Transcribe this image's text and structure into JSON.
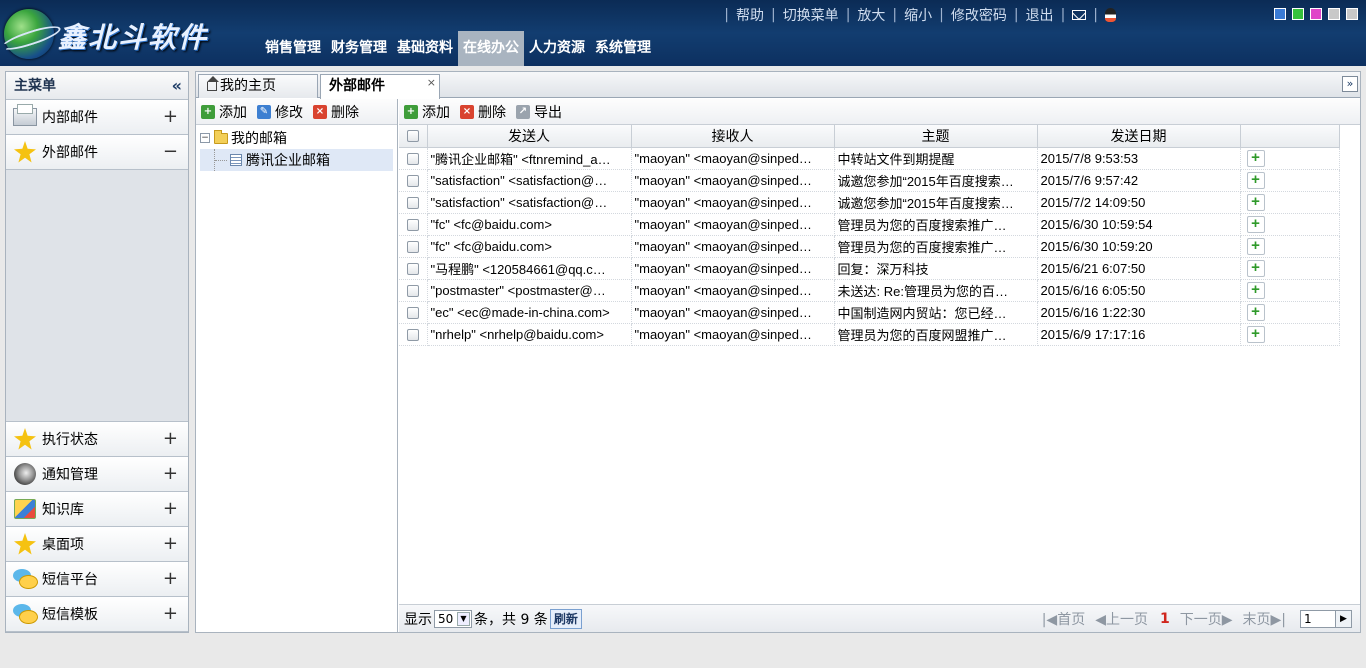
{
  "header": {
    "logo_text": "鑫北斗软件",
    "links": [
      "帮助",
      "切换菜单",
      "放大",
      "缩小",
      "修改密码",
      "退出"
    ],
    "nav": [
      "销售管理",
      "财务管理",
      "基础资料",
      "在线办公",
      "人力资源",
      "系统管理"
    ],
    "active_nav": "在线办公",
    "skin_colors": [
      "#3a7bd5",
      "#36c23b",
      "#e045c8",
      "#c8c8c8",
      "#c8c8c8"
    ]
  },
  "sidebar": {
    "title": "主菜单",
    "items": [
      {
        "label": "内部邮件",
        "icon": "mail-stack-icon",
        "state": "+"
      },
      {
        "label": "外部邮件",
        "icon": "star-icon",
        "state": "−"
      },
      {
        "label": "执行状态",
        "icon": "star-icon",
        "state": "+"
      },
      {
        "label": "通知管理",
        "icon": "speaker-icon",
        "state": "+"
      },
      {
        "label": "知识库",
        "icon": "box-icon",
        "state": "+"
      },
      {
        "label": "桌面项",
        "icon": "star-icon",
        "state": "+"
      },
      {
        "label": "短信平台",
        "icon": "chat-icon",
        "state": "+"
      },
      {
        "label": "短信模板",
        "icon": "chat-icon",
        "state": "+"
      }
    ]
  },
  "tabs": [
    {
      "label": "我的主页"
    },
    {
      "label": "外部邮件",
      "close": "×"
    }
  ],
  "tree_toolbar": {
    "add": "添加",
    "edit": "修改",
    "delete": "删除"
  },
  "tree": {
    "root": "我的邮箱",
    "child": "腾讯企业邮箱"
  },
  "grid_toolbar": {
    "add": "添加",
    "delete": "删除",
    "export": "导出"
  },
  "grid": {
    "columns": [
      "发送人",
      "接收人",
      "主题",
      "发送日期"
    ],
    "rows": [
      {
        "sender": "\"腾讯企业邮箱\" <ftnremind_a…",
        "receiver": "\"maoyan\" <maoyan@sinped…",
        "subject": "中转站文件到期提醒",
        "date": "2015/7/8 9:53:53"
      },
      {
        "sender": "\"satisfaction\" <satisfaction@…",
        "receiver": "\"maoyan\" <maoyan@sinped…",
        "subject": "诚邀您参加“2015年百度搜索…",
        "date": "2015/7/6 9:57:42"
      },
      {
        "sender": "\"satisfaction\" <satisfaction@…",
        "receiver": "\"maoyan\" <maoyan@sinped…",
        "subject": "诚邀您参加“2015年百度搜索…",
        "date": "2015/7/2 14:09:50"
      },
      {
        "sender": "\"fc\" <fc@baidu.com>",
        "receiver": "\"maoyan\" <maoyan@sinped…",
        "subject": "管理员为您的百度搜索推广…",
        "date": "2015/6/30 10:59:54"
      },
      {
        "sender": "\"fc\" <fc@baidu.com>",
        "receiver": "\"maoyan\" <maoyan@sinped…",
        "subject": "管理员为您的百度搜索推广…",
        "date": "2015/6/30 10:59:20"
      },
      {
        "sender": "\"马程鹏\" <120584661@qq.c…",
        "receiver": "\"maoyan\" <maoyan@sinped…",
        "subject": "回复：深万科技",
        "date": "2015/6/21 6:07:50"
      },
      {
        "sender": "\"postmaster\" <postmaster@…",
        "receiver": "\"maoyan\" <maoyan@sinped…",
        "subject": "未送达: Re:管理员为您的百…",
        "date": "2015/6/16 6:05:50"
      },
      {
        "sender": "\"ec\" <ec@made-in-china.com>",
        "receiver": "\"maoyan\" <maoyan@sinped…",
        "subject": "中国制造网内贸站：您已经…",
        "date": "2015/6/16 1:22:30"
      },
      {
        "sender": "\"nrhelp\" <nrhelp@baidu.com>",
        "receiver": "\"maoyan\" <maoyan@sinped…",
        "subject": "管理员为您的百度网盟推广…",
        "date": "2015/6/9 17:17:16"
      }
    ],
    "row_action": "+"
  },
  "pager": {
    "show_label": "显示",
    "page_size": "50",
    "summary": "条，共 9 条",
    "refresh": "刷新",
    "first": "首页",
    "prev": "上一页",
    "current": "1",
    "next": "下一页",
    "last": "末页",
    "goto_value": "1"
  }
}
